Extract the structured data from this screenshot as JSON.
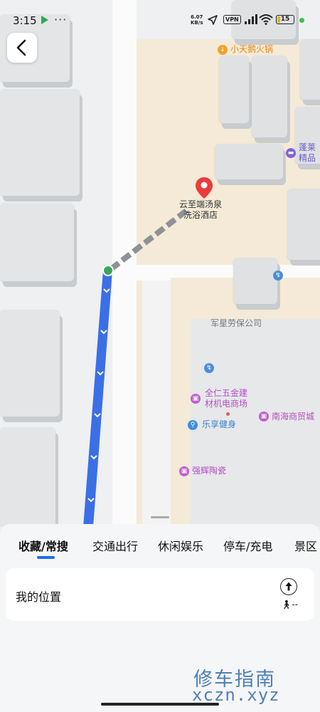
{
  "status_bar": {
    "time": "3:15",
    "more": "···",
    "speed_value": "6.07",
    "speed_unit": "KB/s",
    "vpn": "VPN",
    "battery": "15"
  },
  "map": {
    "pois": {
      "hotpot": "小天鹅火锅",
      "hotel_partial_1": "蓬莱",
      "hotel_partial_2": "精品",
      "destination_line1": "云至端汤泉",
      "destination_line2": "洗浴酒店",
      "labor_company": "军星劳保公司",
      "hardware_line1": "全仁五金建",
      "hardware_line2": "材机电商场",
      "nanhai": "南海商贸城",
      "gym": "乐享健身",
      "ceramics": "强辉陶瓷"
    },
    "colors": {
      "route": "#3b6fe6",
      "pin": "#ea3b3b",
      "beige": "#f4ead7"
    }
  },
  "tabs": [
    {
      "label": "收藏/常搜"
    },
    {
      "label": "交通出行"
    },
    {
      "label": "休闲娱乐"
    },
    {
      "label": "停车/充电"
    },
    {
      "label": "景区"
    }
  ],
  "card": {
    "location": "我的位置",
    "walk_suffix": "--"
  },
  "watermark": {
    "cn": "修车指南",
    "en": "xczn.xyz"
  }
}
